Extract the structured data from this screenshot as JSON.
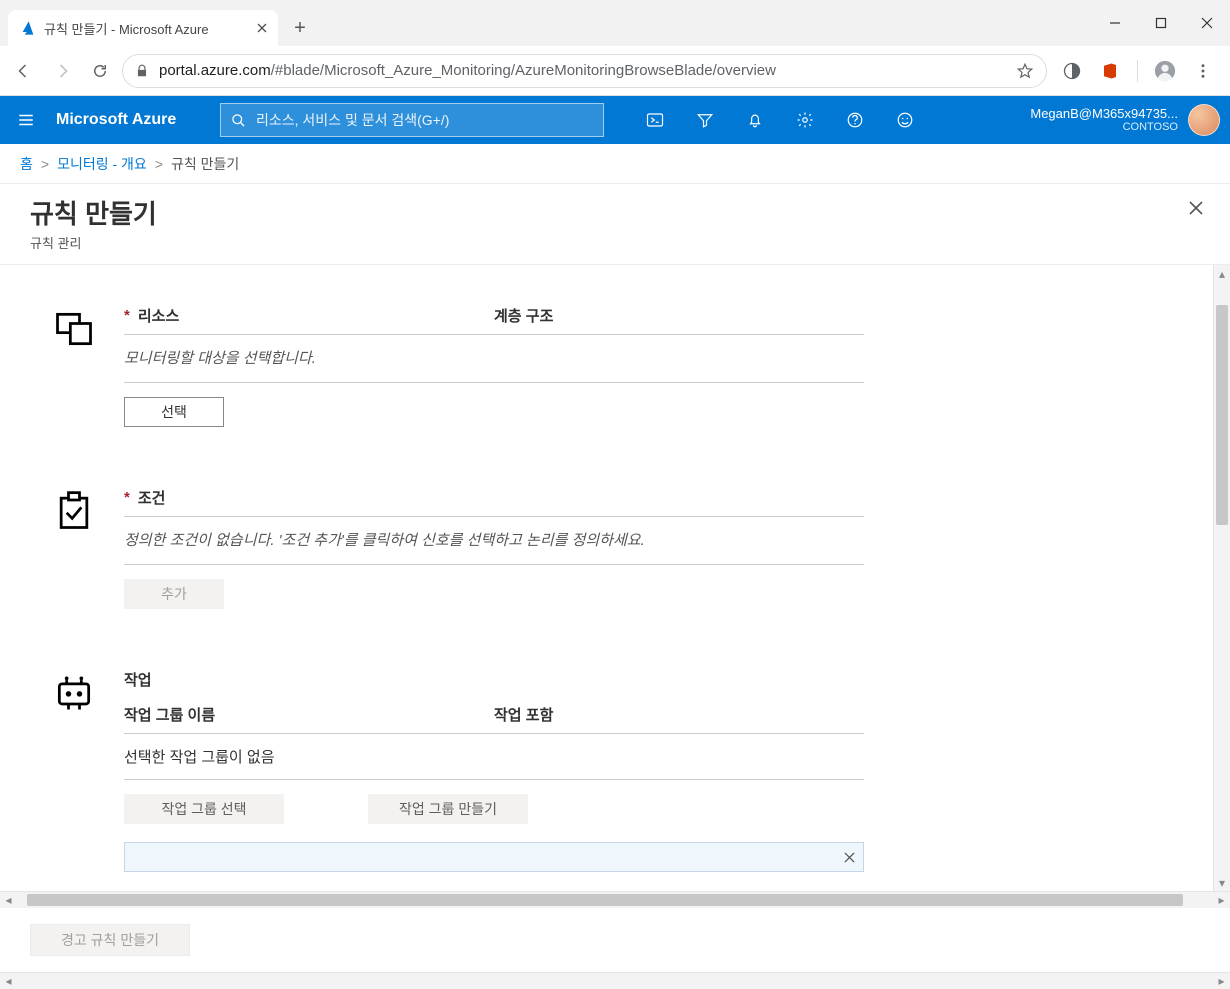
{
  "browser": {
    "tab_title": "규칙 만들기 - Microsoft Azure",
    "url_host": "portal.azure.com",
    "url_path": "/#blade/Microsoft_Azure_Monitoring/AzureMonitoringBrowseBlade/overview"
  },
  "azure": {
    "brand": "Microsoft Azure",
    "search_placeholder": "리소스, 서비스 및 문서 검색(G+/)",
    "user_display": "MeganB@M365x94735...",
    "user_org": "CONTOSO"
  },
  "breadcrumb": {
    "home": "홈",
    "monitoring": "모니터링 - 개요",
    "current": "규칙 만들기"
  },
  "blade": {
    "title": "규칙 만들기",
    "subtitle": "규칙 관리"
  },
  "sections": {
    "resource": {
      "label": "리소스",
      "col2": "계층 구조",
      "desc": "모니터링할 대상을 선택합니다.",
      "select_button": "선택"
    },
    "condition": {
      "label": "조건",
      "desc": "정의한 조건이 없습니다. '조건 추가'를 클릭하여 신호를 선택하고 논리를 정의하세요.",
      "add_button": "추가"
    },
    "action": {
      "label": "작업",
      "col1": "작업 그룹 이름",
      "col2": "작업 포함",
      "none_selected": "선택한 작업 그룹이 없음",
      "select_group": "작업 그룹 선택",
      "create_group": "작업 그룹 만들기"
    }
  },
  "footer": {
    "create_rule": "경고 규칙 만들기"
  }
}
